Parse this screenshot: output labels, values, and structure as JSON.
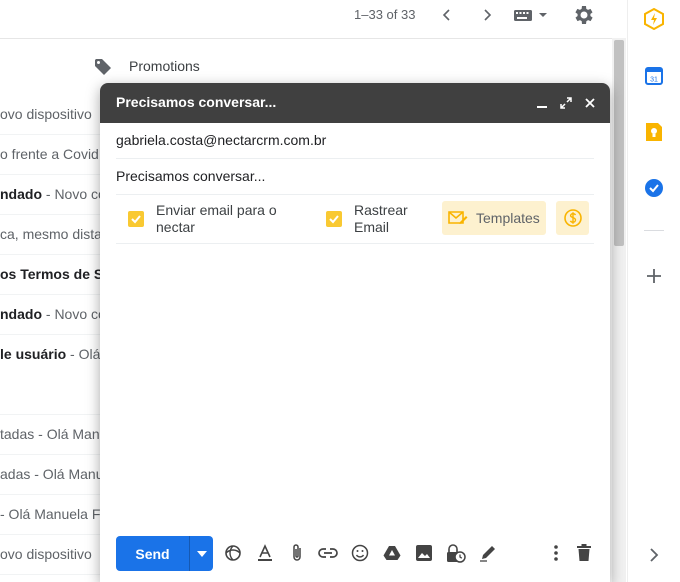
{
  "toolbar": {
    "pager_text": "1–33 of 33"
  },
  "list": {
    "category_label": "Promotions",
    "rows": [
      {
        "bold": "",
        "text": "ovo dispositivo"
      },
      {
        "bold": "",
        "text": "o frente a Covid"
      },
      {
        "bold": "ndado",
        "text": " - Novo co"
      },
      {
        "bold": "",
        "text": "ca, mesmo dista"
      },
      {
        "bold": "os Termos de Se",
        "text": ""
      },
      {
        "bold": "ndado",
        "text": " - Novo co"
      },
      {
        "bold": "le usuário",
        "text": " - Olá M"
      },
      {
        "bold": "",
        "text": "tadas - Olá Manu"
      },
      {
        "bold": "",
        "text": "adas - Olá Manu"
      },
      {
        "bold": "",
        "text": " - Olá Manuela F"
      },
      {
        "bold": "",
        "text": "ovo dispositivo"
      }
    ]
  },
  "compose": {
    "title": "Precisamos conversar...",
    "to": "gabriela.costa@nectarcrm.com.br",
    "subject": "Precisamos conversar...",
    "checkbox_send_line1": "Enviar email para o",
    "checkbox_send_line2": "nectar",
    "checkbox_track_line1": "Rastrear",
    "checkbox_track_line2": "Email",
    "templates_label": "Templates",
    "send_label": "Send"
  },
  "colors": {
    "accent": "#1a73e8",
    "compose_header": "#404040",
    "nectar_yellow": "#f9c932",
    "nectar_bg": "#fdf1cf"
  }
}
